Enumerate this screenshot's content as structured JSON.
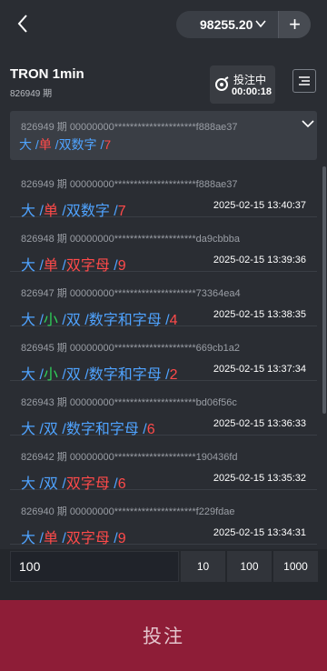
{
  "topbar": {
    "balance": "98255.20",
    "plus": "+"
  },
  "header": {
    "title": "TRON 1min",
    "subtitle": "826949 期",
    "status_label": "投注中",
    "countdown": "00:00:18"
  },
  "latest": {
    "meta": "826949 期   00000000*********************f888ae37",
    "parts": [
      {
        "t": "大",
        "c": "blue"
      },
      {
        "t": " /",
        "c": "sep"
      },
      {
        "t": "单",
        "c": "red"
      },
      {
        "t": " /",
        "c": "sep"
      },
      {
        "t": "双数字",
        "c": "blue"
      },
      {
        "t": " /",
        "c": "sep"
      },
      {
        "t": "7",
        "c": "red"
      }
    ]
  },
  "rows": [
    {
      "meta": "826949 期  00000000*********************f888ae37",
      "date": "2025-02-15 13:40:37",
      "parts": [
        {
          "t": "大",
          "c": "blue"
        },
        {
          "t": " /",
          "c": "sep"
        },
        {
          "t": "单",
          "c": "red"
        },
        {
          "t": " /",
          "c": "sep"
        },
        {
          "t": "双数字",
          "c": "blue"
        },
        {
          "t": " /",
          "c": "sep"
        },
        {
          "t": "7",
          "c": "red"
        }
      ]
    },
    {
      "meta": "826948 期  00000000*********************da9cbbba",
      "date": "2025-02-15 13:39:36",
      "parts": [
        {
          "t": "大",
          "c": "blue"
        },
        {
          "t": " /",
          "c": "sep"
        },
        {
          "t": "单",
          "c": "red"
        },
        {
          "t": " /",
          "c": "sep"
        },
        {
          "t": "双字母",
          "c": "red"
        },
        {
          "t": " /",
          "c": "sep"
        },
        {
          "t": "9",
          "c": "red"
        }
      ]
    },
    {
      "meta": "826947 期  00000000*********************73364ea4",
      "date": "2025-02-15 13:38:35",
      "parts": [
        {
          "t": "大",
          "c": "blue"
        },
        {
          "t": " /",
          "c": "sep"
        },
        {
          "t": "小",
          "c": "green"
        },
        {
          "t": " /",
          "c": "sep"
        },
        {
          "t": "双",
          "c": "blue"
        },
        {
          "t": " /",
          "c": "sep"
        },
        {
          "t": "数字和字母",
          "c": "blue"
        },
        {
          "t": " /",
          "c": "sep"
        },
        {
          "t": "4",
          "c": "red"
        }
      ]
    },
    {
      "meta": "826945 期  00000000*********************669cb1a2",
      "date": "2025-02-15 13:37:34",
      "parts": [
        {
          "t": "大",
          "c": "blue"
        },
        {
          "t": " /",
          "c": "sep"
        },
        {
          "t": "小",
          "c": "green"
        },
        {
          "t": " /",
          "c": "sep"
        },
        {
          "t": "双",
          "c": "blue"
        },
        {
          "t": " /",
          "c": "sep"
        },
        {
          "t": "数字和字母",
          "c": "blue"
        },
        {
          "t": " /",
          "c": "sep"
        },
        {
          "t": "2",
          "c": "red"
        }
      ]
    },
    {
      "meta": "826943 期  00000000*********************bd06f56c",
      "date": "2025-02-15 13:36:33",
      "parts": [
        {
          "t": "大",
          "c": "blue"
        },
        {
          "t": " /",
          "c": "sep"
        },
        {
          "t": "双",
          "c": "blue"
        },
        {
          "t": " /",
          "c": "sep"
        },
        {
          "t": "数字和字母",
          "c": "blue"
        },
        {
          "t": " /",
          "c": "sep"
        },
        {
          "t": "6",
          "c": "red"
        }
      ]
    },
    {
      "meta": "826942 期  00000000*********************190436fd",
      "date": "2025-02-15 13:35:32",
      "parts": [
        {
          "t": "大",
          "c": "blue"
        },
        {
          "t": " /",
          "c": "sep"
        },
        {
          "t": "双",
          "c": "blue"
        },
        {
          "t": " /",
          "c": "sep"
        },
        {
          "t": "双字母",
          "c": "red"
        },
        {
          "t": " /",
          "c": "sep"
        },
        {
          "t": "6",
          "c": "red"
        }
      ]
    },
    {
      "meta": "826940 期  00000000*********************f229fdae",
      "date": "2025-02-15 13:34:31",
      "parts": [
        {
          "t": "大",
          "c": "blue"
        },
        {
          "t": " /",
          "c": "sep"
        },
        {
          "t": "单",
          "c": "red"
        },
        {
          "t": " /",
          "c": "sep"
        },
        {
          "t": "双字母",
          "c": "red"
        },
        {
          "t": " /",
          "c": "sep"
        },
        {
          "t": "9",
          "c": "red"
        }
      ]
    }
  ],
  "bet": {
    "amount": "100",
    "chips": [
      "10",
      "100",
      "1000"
    ],
    "submit_label": "投注"
  },
  "colors": {
    "blue": "#4fa3ff",
    "red": "#ff4a4a",
    "green": "#2fd05a",
    "submit_bg": "#8e1d37"
  }
}
